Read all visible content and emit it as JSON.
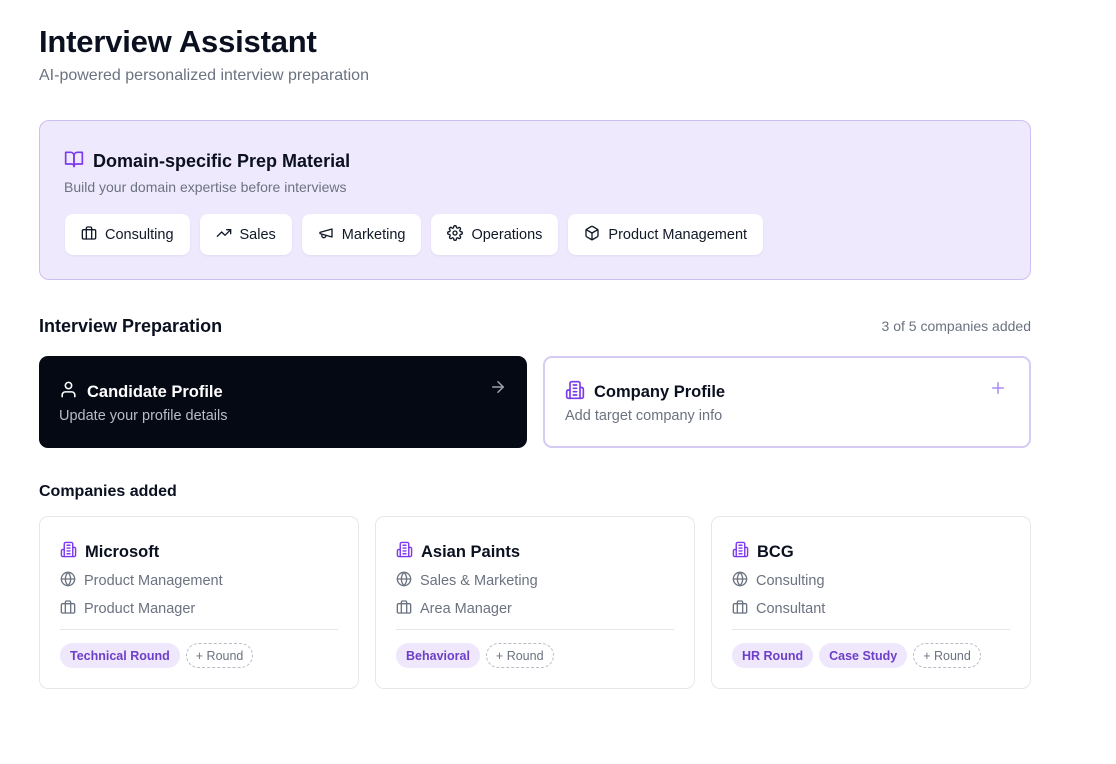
{
  "header": {
    "title": "Interview Assistant",
    "subtitle": "AI-powered personalized interview preparation"
  },
  "domain_prep": {
    "title": "Domain-specific Prep Material",
    "subtitle": "Build your domain expertise before interviews",
    "chips": [
      {
        "label": "Consulting",
        "icon": "briefcase-icon"
      },
      {
        "label": "Sales",
        "icon": "trending-up-icon"
      },
      {
        "label": "Marketing",
        "icon": "megaphone-icon"
      },
      {
        "label": "Operations",
        "icon": "gear-icon"
      },
      {
        "label": "Product Management",
        "icon": "box-icon"
      }
    ]
  },
  "preparation": {
    "title": "Interview Preparation",
    "count_text": "3 of 5 companies added",
    "candidate": {
      "title": "Candidate Profile",
      "subtitle": "Update your profile details",
      "icon": "user-icon",
      "action_icon": "arrow-right-icon"
    },
    "company": {
      "title": "Company Profile",
      "subtitle": "Add target company info",
      "icon": "building-icon",
      "action_icon": "plus-icon"
    }
  },
  "companies": {
    "title": "Companies added",
    "add_round_label": "+ Round",
    "items": [
      {
        "name": "Microsoft",
        "domain": "Product Management",
        "role": "Product Manager",
        "rounds": [
          "Technical Round"
        ]
      },
      {
        "name": "Asian Paints",
        "domain": "Sales & Marketing",
        "role": "Area Manager",
        "rounds": [
          "Behavioral"
        ]
      },
      {
        "name": "BCG",
        "domain": "Consulting",
        "role": "Consultant",
        "rounds": [
          "HR Round",
          "Case Study"
        ]
      }
    ]
  },
  "colors": {
    "accent": "#7c3aed",
    "accent_bg": "#efe9fd",
    "dark_card": "#050914",
    "tag_bg": "#efe7fc",
    "tag_text": "#6d3fc6"
  }
}
